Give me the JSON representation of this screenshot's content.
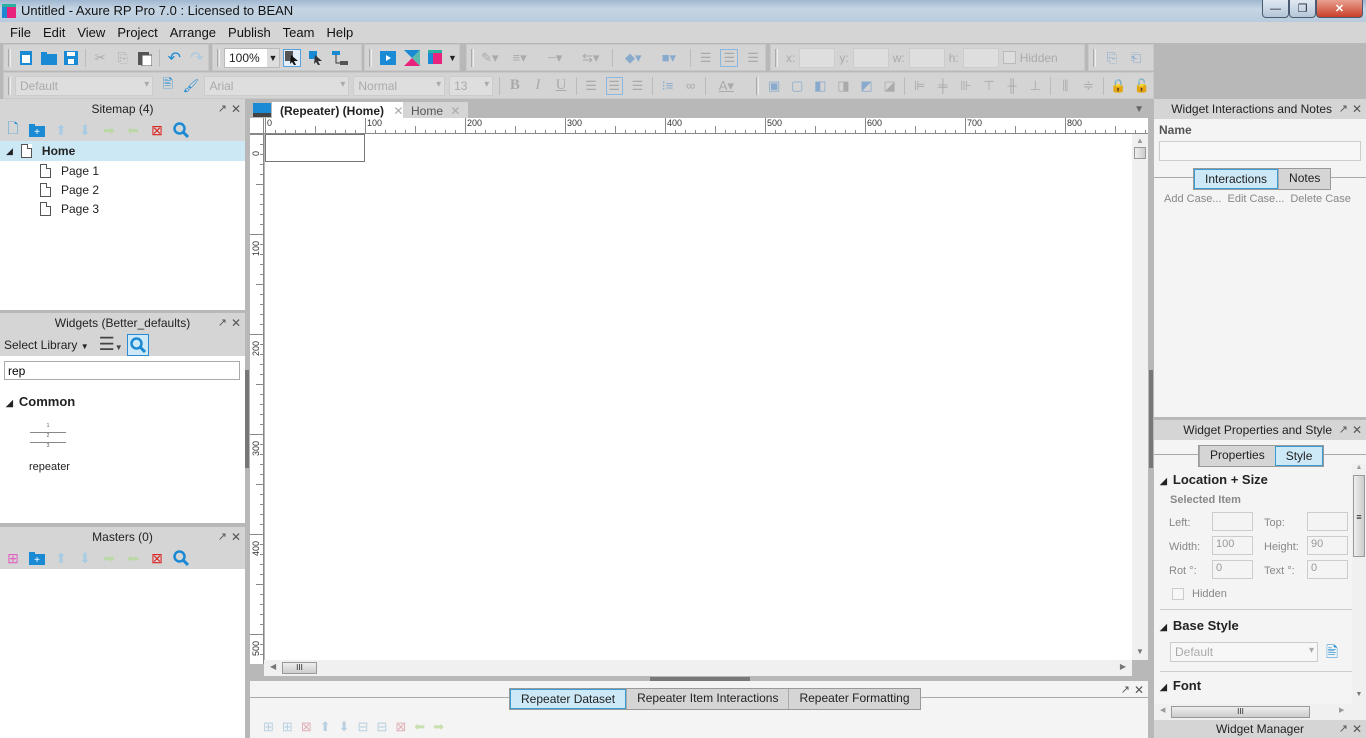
{
  "window": {
    "title": "Untitled - Axure RP Pro 7.0 : Licensed to BEAN",
    "minimize": "—",
    "restore": "❐",
    "close": "✕"
  },
  "menu": [
    "File",
    "Edit",
    "View",
    "Project",
    "Arrange",
    "Publish",
    "Team",
    "Help"
  ],
  "toolbar": {
    "zoom": "100%",
    "style_dropdown": "Default",
    "font_dropdown": "Arial",
    "weight_dropdown": "Normal",
    "size_dropdown": "13",
    "x_label": "x:",
    "y_label": "y:",
    "w_label": "w:",
    "h_label": "h:",
    "hidden_label": "Hidden",
    "bold": "B",
    "italic": "I",
    "underline": "U"
  },
  "sitemap": {
    "title": "Sitemap (4)",
    "pages": [
      {
        "label": "Home",
        "selected": true
      },
      {
        "label": "Page 1"
      },
      {
        "label": "Page 2"
      },
      {
        "label": "Page 3"
      }
    ]
  },
  "widgets": {
    "title": "Widgets (Better_defaults)",
    "select_library": "Select Library",
    "search_value": "rep",
    "category": "Common",
    "items": [
      {
        "label": "repeater"
      }
    ],
    "repeater_rows": [
      "1",
      "2",
      "3"
    ]
  },
  "masters": {
    "title": "Masters (0)"
  },
  "canvas": {
    "tabs": [
      {
        "label": "(Repeater) (Home)",
        "active": true
      },
      {
        "label": "Home",
        "active": false
      }
    ],
    "ruler_h": [
      "0",
      "100",
      "200",
      "300",
      "400",
      "500",
      "600",
      "700",
      "800"
    ],
    "ruler_v": [
      "0",
      "100",
      "200",
      "300",
      "400",
      "500"
    ]
  },
  "repeater_panel": {
    "tabs": [
      {
        "label": "Repeater Dataset",
        "active": true
      },
      {
        "label": "Repeater Item Interactions",
        "active": false
      },
      {
        "label": "Repeater Formatting",
        "active": false
      }
    ]
  },
  "interactions_panel": {
    "title": "Widget Interactions and Notes",
    "name_label": "Name",
    "name_value": "",
    "tabs": [
      {
        "label": "Interactions",
        "active": true
      },
      {
        "label": "Notes",
        "active": false
      }
    ],
    "actions": [
      "Add Case...",
      "Edit Case...",
      "Delete Case"
    ]
  },
  "properties_panel": {
    "title": "Widget Properties and Style",
    "tabs": [
      {
        "label": "Properties",
        "active": false
      },
      {
        "label": "Style",
        "active": true
      }
    ],
    "location_size": {
      "heading": "Location + Size",
      "subheading": "Selected Item",
      "left_label": "Left:",
      "left_value": "",
      "top_label": "Top:",
      "top_value": "",
      "width_label": "Width:",
      "width_value": "100",
      "height_label": "Height:",
      "height_value": "90",
      "rot_label": "Rot °:",
      "rot_value": "0",
      "text_label": "Text °:",
      "text_value": "0",
      "hidden_label": "Hidden"
    },
    "base_style": {
      "heading": "Base Style",
      "value": "Default"
    },
    "font": {
      "heading": "Font"
    }
  },
  "widget_manager": {
    "title": "Widget Manager"
  }
}
